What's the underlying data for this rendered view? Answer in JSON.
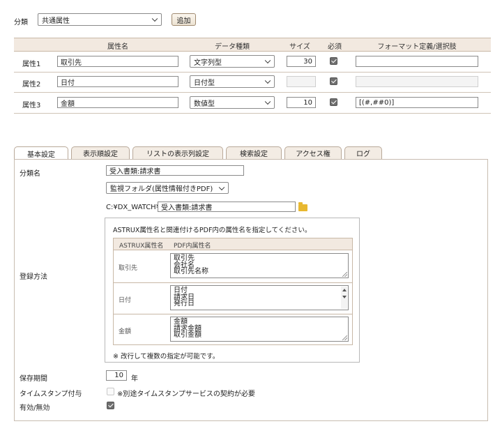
{
  "top": {
    "category_label": "分類",
    "category_value": "共通属性",
    "add_button": "追加"
  },
  "attr_table": {
    "headers": {
      "name": "属性名",
      "type": "データ種類",
      "size": "サイズ",
      "required": "必須",
      "format": "フォーマット定義/選択肢"
    },
    "rows": [
      {
        "label": "属性1",
        "name": "取引先",
        "type": "文字列型",
        "size": "30",
        "required": true,
        "format": ""
      },
      {
        "label": "属性2",
        "name": "日付",
        "type": "日付型",
        "size": "",
        "required": true,
        "format": ""
      },
      {
        "label": "属性3",
        "name": "金額",
        "type": "数値型",
        "size": "10",
        "required": true,
        "format": "[(#,##0)]"
      }
    ]
  },
  "tabs": [
    "基本設定",
    "表示順設定",
    "リストの表示列設定",
    "検索設定",
    "アクセス権",
    "ログ"
  ],
  "basic": {
    "category_name_label": "分類名",
    "category_name_value": "受入書類:請求書",
    "method_label": "登録方法",
    "method_select": "監視フォルダ(属性情報付きPDF)",
    "folder_prefix": "C:¥DX_WATCH¥",
    "folder_value": "受入書類:請求書",
    "mapping_instruction": "ASTRUX属性名と関連付けるPDF内の属性名を指定してください。",
    "mapping_headers": {
      "astrux": "ASTRUX属性名",
      "pdf": "PDF内属性名"
    },
    "mapping_rows": [
      {
        "astrux": "取引先",
        "pdf_lines": [
          "取引先",
          "会社名",
          "取引先名称"
        ]
      },
      {
        "astrux": "日付",
        "pdf_lines": [
          "日付",
          "請求日",
          "発行日"
        ]
      },
      {
        "astrux": "金額",
        "pdf_lines": [
          "金額",
          "請求金額",
          "取引金額"
        ]
      }
    ],
    "mapping_note": "※ 改行して複数の指定が可能です。",
    "retention_label": "保存期間",
    "retention_value": "10",
    "retention_unit": "年",
    "timestamp_label": "タイムスタンプ付与",
    "timestamp_note": "※別途タイムスタンプサービスの契約が必要",
    "timestamp_checked": false,
    "enabled_label": "有効/無効",
    "enabled_checked": true
  }
}
